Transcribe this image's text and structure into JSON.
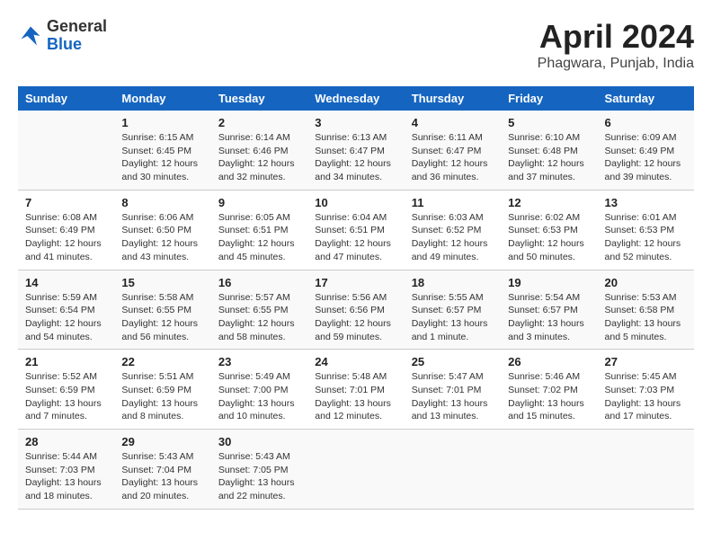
{
  "header": {
    "logo": {
      "general": "General",
      "blue": "Blue",
      "bird_color": "#1565c0"
    },
    "title": "April 2024",
    "location": "Phagwara, Punjab, India"
  },
  "calendar": {
    "days_of_week": [
      "Sunday",
      "Monday",
      "Tuesday",
      "Wednesday",
      "Thursday",
      "Friday",
      "Saturday"
    ],
    "weeks": [
      [
        {
          "day": "",
          "info": ""
        },
        {
          "day": "1",
          "info": "Sunrise: 6:15 AM\nSunset: 6:45 PM\nDaylight: 12 hours\nand 30 minutes."
        },
        {
          "day": "2",
          "info": "Sunrise: 6:14 AM\nSunset: 6:46 PM\nDaylight: 12 hours\nand 32 minutes."
        },
        {
          "day": "3",
          "info": "Sunrise: 6:13 AM\nSunset: 6:47 PM\nDaylight: 12 hours\nand 34 minutes."
        },
        {
          "day": "4",
          "info": "Sunrise: 6:11 AM\nSunset: 6:47 PM\nDaylight: 12 hours\nand 36 minutes."
        },
        {
          "day": "5",
          "info": "Sunrise: 6:10 AM\nSunset: 6:48 PM\nDaylight: 12 hours\nand 37 minutes."
        },
        {
          "day": "6",
          "info": "Sunrise: 6:09 AM\nSunset: 6:49 PM\nDaylight: 12 hours\nand 39 minutes."
        }
      ],
      [
        {
          "day": "7",
          "info": "Sunrise: 6:08 AM\nSunset: 6:49 PM\nDaylight: 12 hours\nand 41 minutes."
        },
        {
          "day": "8",
          "info": "Sunrise: 6:06 AM\nSunset: 6:50 PM\nDaylight: 12 hours\nand 43 minutes."
        },
        {
          "day": "9",
          "info": "Sunrise: 6:05 AM\nSunset: 6:51 PM\nDaylight: 12 hours\nand 45 minutes."
        },
        {
          "day": "10",
          "info": "Sunrise: 6:04 AM\nSunset: 6:51 PM\nDaylight: 12 hours\nand 47 minutes."
        },
        {
          "day": "11",
          "info": "Sunrise: 6:03 AM\nSunset: 6:52 PM\nDaylight: 12 hours\nand 49 minutes."
        },
        {
          "day": "12",
          "info": "Sunrise: 6:02 AM\nSunset: 6:53 PM\nDaylight: 12 hours\nand 50 minutes."
        },
        {
          "day": "13",
          "info": "Sunrise: 6:01 AM\nSunset: 6:53 PM\nDaylight: 12 hours\nand 52 minutes."
        }
      ],
      [
        {
          "day": "14",
          "info": "Sunrise: 5:59 AM\nSunset: 6:54 PM\nDaylight: 12 hours\nand 54 minutes."
        },
        {
          "day": "15",
          "info": "Sunrise: 5:58 AM\nSunset: 6:55 PM\nDaylight: 12 hours\nand 56 minutes."
        },
        {
          "day": "16",
          "info": "Sunrise: 5:57 AM\nSunset: 6:55 PM\nDaylight: 12 hours\nand 58 minutes."
        },
        {
          "day": "17",
          "info": "Sunrise: 5:56 AM\nSunset: 6:56 PM\nDaylight: 12 hours\nand 59 minutes."
        },
        {
          "day": "18",
          "info": "Sunrise: 5:55 AM\nSunset: 6:57 PM\nDaylight: 13 hours\nand 1 minute."
        },
        {
          "day": "19",
          "info": "Sunrise: 5:54 AM\nSunset: 6:57 PM\nDaylight: 13 hours\nand 3 minutes."
        },
        {
          "day": "20",
          "info": "Sunrise: 5:53 AM\nSunset: 6:58 PM\nDaylight: 13 hours\nand 5 minutes."
        }
      ],
      [
        {
          "day": "21",
          "info": "Sunrise: 5:52 AM\nSunset: 6:59 PM\nDaylight: 13 hours\nand 7 minutes."
        },
        {
          "day": "22",
          "info": "Sunrise: 5:51 AM\nSunset: 6:59 PM\nDaylight: 13 hours\nand 8 minutes."
        },
        {
          "day": "23",
          "info": "Sunrise: 5:49 AM\nSunset: 7:00 PM\nDaylight: 13 hours\nand 10 minutes."
        },
        {
          "day": "24",
          "info": "Sunrise: 5:48 AM\nSunset: 7:01 PM\nDaylight: 13 hours\nand 12 minutes."
        },
        {
          "day": "25",
          "info": "Sunrise: 5:47 AM\nSunset: 7:01 PM\nDaylight: 13 hours\nand 13 minutes."
        },
        {
          "day": "26",
          "info": "Sunrise: 5:46 AM\nSunset: 7:02 PM\nDaylight: 13 hours\nand 15 minutes."
        },
        {
          "day": "27",
          "info": "Sunrise: 5:45 AM\nSunset: 7:03 PM\nDaylight: 13 hours\nand 17 minutes."
        }
      ],
      [
        {
          "day": "28",
          "info": "Sunrise: 5:44 AM\nSunset: 7:03 PM\nDaylight: 13 hours\nand 18 minutes."
        },
        {
          "day": "29",
          "info": "Sunrise: 5:43 AM\nSunset: 7:04 PM\nDaylight: 13 hours\nand 20 minutes."
        },
        {
          "day": "30",
          "info": "Sunrise: 5:43 AM\nSunset: 7:05 PM\nDaylight: 13 hours\nand 22 minutes."
        },
        {
          "day": "",
          "info": ""
        },
        {
          "day": "",
          "info": ""
        },
        {
          "day": "",
          "info": ""
        },
        {
          "day": "",
          "info": ""
        }
      ]
    ]
  }
}
